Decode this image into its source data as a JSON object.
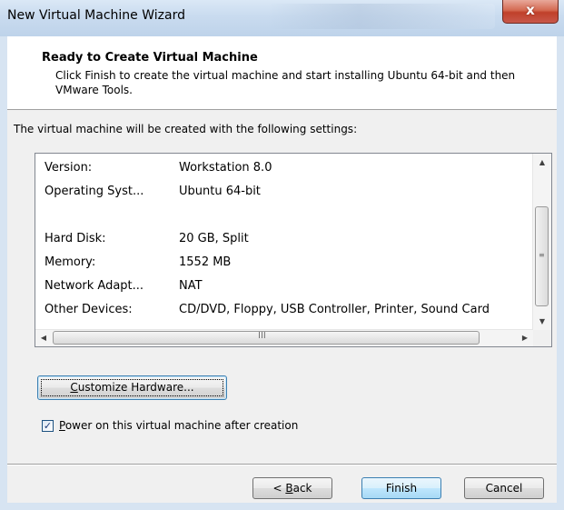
{
  "window": {
    "title": "New Virtual Machine Wizard",
    "close_glyph": "x"
  },
  "header": {
    "title": "Ready to Create Virtual Machine",
    "description": "Click Finish to create the virtual machine and start installing Ubuntu 64-bit and then VMware Tools."
  },
  "intro": "The virtual machine will be created with the following settings:",
  "settings": [
    {
      "key": "Version:",
      "value": "Workstation 8.0"
    },
    {
      "key": "Operating Syst...",
      "value": "Ubuntu 64-bit"
    },
    {
      "key": "Hard Disk:",
      "value": "20 GB, Split"
    },
    {
      "key": "Memory:",
      "value": "1552 MB"
    },
    {
      "key": "Network Adapt...",
      "value": "NAT"
    },
    {
      "key": "Other Devices:",
      "value": "CD/DVD, Floppy, USB Controller, Printer, Sound Card"
    }
  ],
  "scrollbar": {
    "up": "▲",
    "down": "▼",
    "left": "◀",
    "right": "▶",
    "v_grip": "≡",
    "h_grip": "III"
  },
  "buttons": {
    "customize": {
      "accel": "C",
      "rest": "ustomize Hardware..."
    },
    "back": {
      "pre": "< ",
      "accel": "B",
      "rest": "ack"
    },
    "finish": "Finish",
    "cancel": "Cancel"
  },
  "power_on": {
    "checked": true,
    "check_glyph": "✓",
    "accel": "P",
    "rest": "ower on this virtual machine after creation"
  },
  "colors": {
    "titlebar": "#c9dbef",
    "close": "#c0402a",
    "accent": "#3c7fb1"
  }
}
